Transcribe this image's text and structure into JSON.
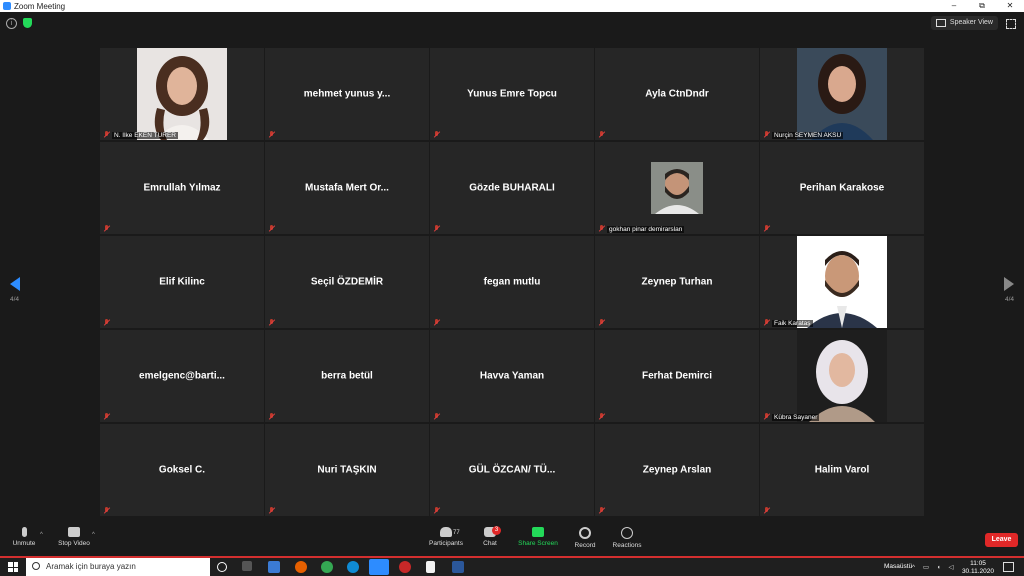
{
  "window": {
    "title": "Zoom Meeting",
    "controls": [
      "–",
      "⧉",
      "✕"
    ]
  },
  "topbar": {
    "speaker_view": "Speaker View"
  },
  "pagination": {
    "left": "4/4",
    "right": "4/4"
  },
  "participants": [
    {
      "name": "",
      "label": "N. Ilke EKEN TURER",
      "photo": "woman-curly-hair"
    },
    {
      "name": "mehmet yunus y...",
      "label": ""
    },
    {
      "name": "Yunus Emre Topcu",
      "label": ""
    },
    {
      "name": "Ayla CtnDndr",
      "label": ""
    },
    {
      "name": "",
      "label": "Nurçin SEYMEN AKSU",
      "photo": "woman-dark-hair"
    },
    {
      "name": "Emrullah Yılmaz",
      "label": ""
    },
    {
      "name": "Mustafa Mert Or...",
      "label": ""
    },
    {
      "name": "Gözde BUHARALI",
      "label": ""
    },
    {
      "name": "",
      "label": "gokhan pinar demirarslan",
      "photo": "man-beard-small"
    },
    {
      "name": "Perihan Karakose",
      "label": ""
    },
    {
      "name": "Elif Kilinc",
      "label": ""
    },
    {
      "name": "Seçil ÖZDEMİR",
      "label": ""
    },
    {
      "name": "fegan mutlu",
      "label": ""
    },
    {
      "name": "Zeynep Turhan",
      "label": ""
    },
    {
      "name": "",
      "label": "Faik Karataş",
      "photo": "man-beard-suit"
    },
    {
      "name": "emelgenc@barti...",
      "label": ""
    },
    {
      "name": "berra betül",
      "label": ""
    },
    {
      "name": "Havva Yaman",
      "label": ""
    },
    {
      "name": "Ferhat Demirci",
      "label": ""
    },
    {
      "name": "",
      "label": "Kübra Sayaner",
      "photo": "woman-headscarf"
    },
    {
      "name": "Goksel C.",
      "label": ""
    },
    {
      "name": "Nuri TAŞKIN",
      "label": ""
    },
    {
      "name": "GÜL ÖZCAN/ TÜ...",
      "label": ""
    },
    {
      "name": "Zeynep Arslan",
      "label": ""
    },
    {
      "name": "Halim Varol",
      "label": ""
    }
  ],
  "toolbar": {
    "unmute": "Unmute",
    "stop_video": "Stop Video",
    "participants": "Participants",
    "participants_count": "77",
    "chat": "Chat",
    "chat_badge": "3",
    "share_screen": "Share Screen",
    "record": "Record",
    "reactions": "Reactions",
    "leave": "Leave"
  },
  "taskbar": {
    "search_placeholder": "Aramak için buraya yazın",
    "desktop": "Masaüstü",
    "time": "11:05",
    "date": "30.11.2020"
  },
  "colors": {
    "accent": "#2d8cff",
    "leave": "#e02828",
    "share": "#23d959",
    "tile": "#262626"
  }
}
